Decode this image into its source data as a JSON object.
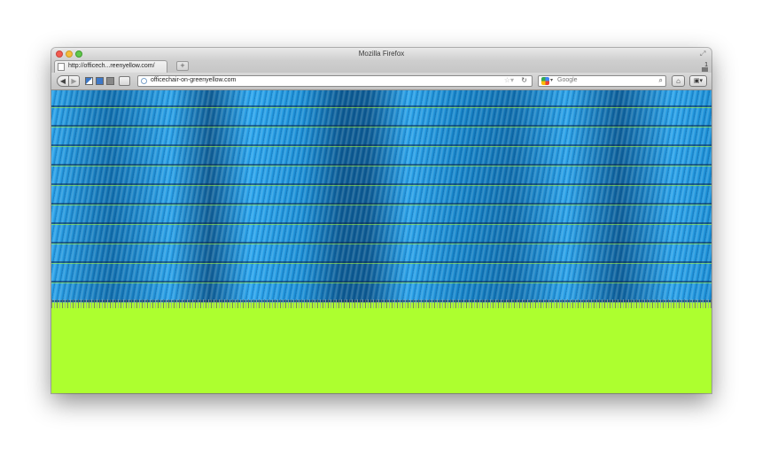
{
  "window": {
    "title": "Mozilla Firefox"
  },
  "tabs": [
    {
      "title": "http://officech...reenyellow.com/"
    }
  ],
  "tab_count": "1",
  "navigation": {
    "url": "officechair-on-greenyellow.com",
    "search_placeholder": "Google"
  },
  "colors": {
    "page_background": "#adff2f",
    "chair_blue": "#1a8fd6"
  },
  "icons": {
    "back": "back-arrow-icon",
    "forward": "forward-arrow-icon",
    "reload": "reload-icon",
    "bookmark": "star-icon",
    "search": "magnifier-icon",
    "home": "home-icon"
  }
}
